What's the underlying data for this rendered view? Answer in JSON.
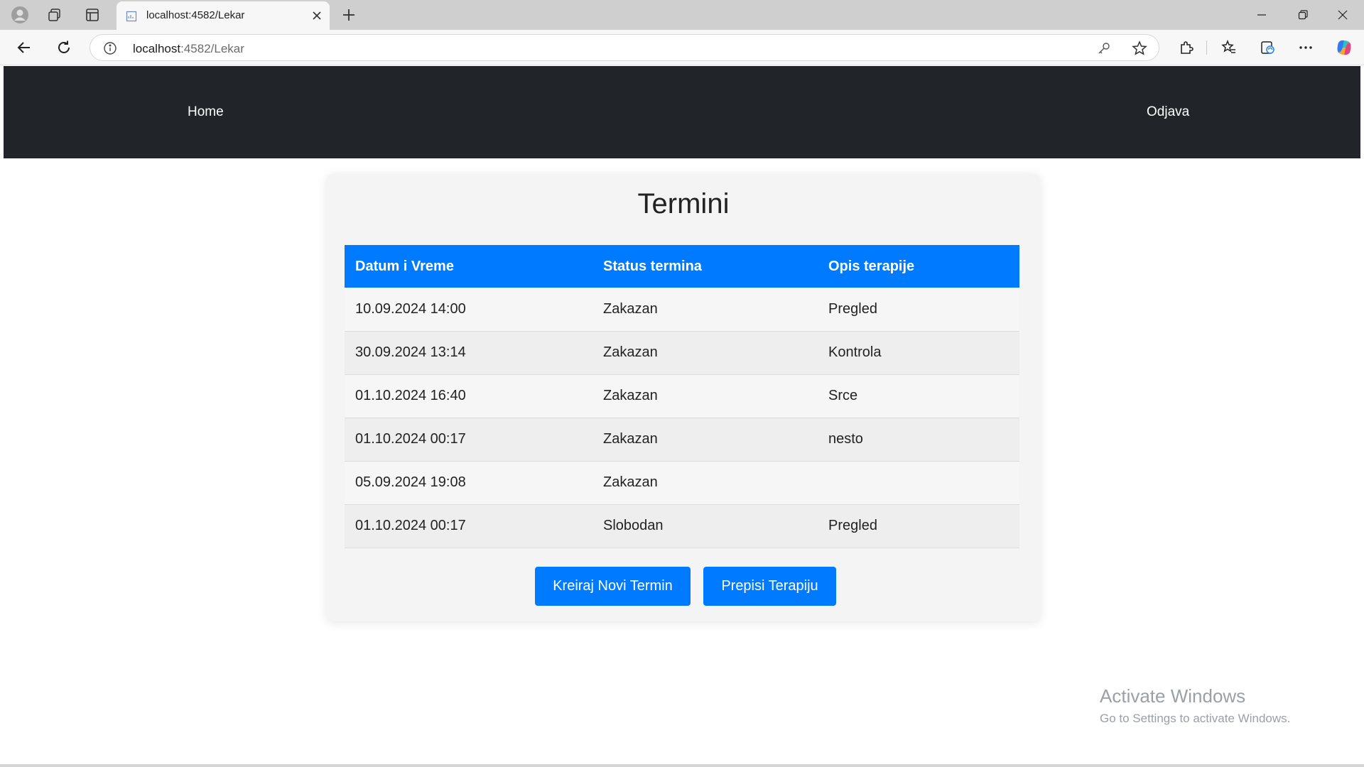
{
  "browser": {
    "tab_title": "localhost:4582/Lekar",
    "url_host": "localhost",
    "url_path": ":4582/Lekar",
    "icons": [
      "profile-icon",
      "workspaces-icon",
      "tab-actions-icon",
      "page-favicon",
      "close-icon",
      "plus-icon",
      "minimize-icon",
      "restore-icon",
      "window-close-icon",
      "back-icon",
      "refresh-icon",
      "info-icon",
      "key-icon",
      "star-icon",
      "extensions-icon",
      "favorites-icon",
      "collections-icon",
      "more-icon",
      "copilot-icon"
    ]
  },
  "navbar": {
    "home": "Home",
    "logout": "Odjava"
  },
  "card": {
    "title": "Termini",
    "columns": [
      "Datum i Vreme",
      "Status termina",
      "Opis terapije"
    ],
    "rows": [
      [
        "10.09.2024 14:00",
        "Zakazan",
        "Pregled"
      ],
      [
        "30.09.2024 13:14",
        "Zakazan",
        "Kontrola"
      ],
      [
        "01.10.2024 16:40",
        "Zakazan",
        "Srce"
      ],
      [
        "01.10.2024 00:17",
        "Zakazan",
        "nesto"
      ],
      [
        "05.09.2024 19:08",
        "Zakazan",
        ""
      ],
      [
        "01.10.2024 00:17",
        "Slobodan",
        "Pregled"
      ]
    ],
    "create_button": "Kreiraj Novi Termin",
    "prescribe_button": "Prepisi Terapiju"
  },
  "watermark": {
    "line1": "Activate Windows",
    "line2": "Go to Settings to activate Windows."
  },
  "colors": {
    "navbar": "#212529",
    "primary": "#007bff"
  }
}
